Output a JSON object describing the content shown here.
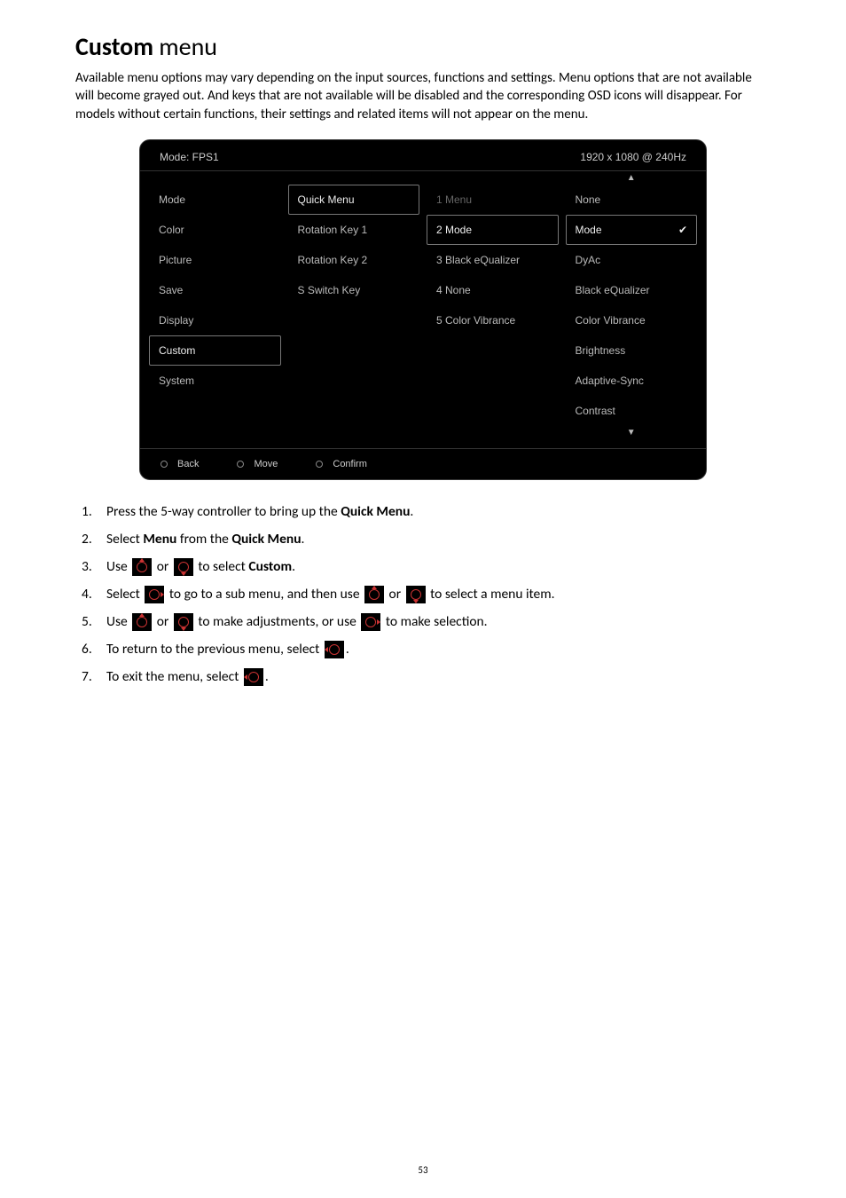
{
  "title_bold": "Custom",
  "title_rest": " menu",
  "intro": "Available menu options may vary depending on the input sources, functions and settings. Menu options that are not available will become grayed out. And keys that are not available will be disabled and the corresponding OSD icons will disappear. For models without certain functions, their settings and related items will not appear on the menu.",
  "osd": {
    "mode_label": "Mode: FPS1",
    "resolution": "1920 x 1080 @ 240Hz",
    "col1": [
      "Mode",
      "Color",
      "Picture",
      "Save",
      "Display",
      "Custom",
      "System"
    ],
    "col1_highlight_index": 5,
    "col2": [
      "Quick Menu",
      "Rotation Key 1",
      "Rotation Key 2",
      "S Switch Key"
    ],
    "col2_highlight_index": 0,
    "col3": [
      "1 Menu",
      "2 Mode",
      "3 Black eQualizer",
      "4 None",
      "5 Color Vibrance"
    ],
    "col3_dim_index": 0,
    "col3_highlight_index": 1,
    "col4": [
      "None",
      "Mode",
      "DyAc",
      "Black eQualizer",
      "Color Vibrance",
      "Brightness",
      "Adaptive-Sync",
      "Contrast"
    ],
    "col4_highlight_index": 1,
    "controls": {
      "back": "Back",
      "move": "Move",
      "confirm": "Confirm"
    }
  },
  "steps": {
    "s1_a": "Press the 5-way controller to bring up the ",
    "s1_b": "Quick Menu",
    "s1_c": ".",
    "s2_a": "Select ",
    "s2_b": "Menu",
    "s2_c": " from the ",
    "s2_d": "Quick Menu",
    "s2_e": ".",
    "s3_a": "Use ",
    "s3_b": " or ",
    "s3_c": " to select ",
    "s3_d": "Custom",
    "s3_e": ".",
    "s4_a": "Select ",
    "s4_b": " to go to a sub menu, and then use ",
    "s4_c": " or ",
    "s4_d": " to select a menu item.",
    "s5_a": "Use ",
    "s5_b": " or ",
    "s5_c": " to make adjustments, or use ",
    "s5_d": " to make selection.",
    "s6_a": "To return to the previous menu, select ",
    "s6_b": ".",
    "s7_a": "To exit the menu, select ",
    "s7_b": "."
  },
  "page_number": "53"
}
